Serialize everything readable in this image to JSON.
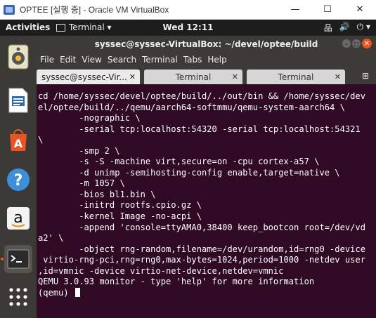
{
  "host": {
    "title": "OPTEE [실행 중] - Oracle VM VirtualBox",
    "controls": {
      "minimize": "—",
      "maximize": "☐",
      "close": "✕"
    }
  },
  "panel": {
    "activities": "Activities",
    "app_menu": "Terminal ▾",
    "clock": "Wed 12:11",
    "tray": {
      "network": "品",
      "volume": "🔊",
      "power": "⏻ ▾"
    }
  },
  "dock": {
    "items": [
      {
        "name": "rhythmbox"
      },
      {
        "name": "libreoffice-writer"
      },
      {
        "name": "ubuntu-software"
      },
      {
        "name": "help"
      },
      {
        "name": "amazon"
      },
      {
        "name": "terminal"
      },
      {
        "name": "show-applications"
      }
    ],
    "accent": "#e95420"
  },
  "terminal": {
    "title": "syssec@syssec-VirtualBox: ~/devel/optee/build",
    "menu": [
      "File",
      "Edit",
      "View",
      "Search",
      "Terminal",
      "Tabs",
      "Help"
    ],
    "tabs": [
      {
        "label": "syssec@syssec-Vir...",
        "active": true,
        "close": "✕"
      },
      {
        "label": "Terminal",
        "active": false,
        "close": "✕"
      },
      {
        "label": "Terminal",
        "active": false,
        "close": "✕"
      }
    ],
    "lines": [
      "cd /home/syssec/devel/optee/build/../out/bin && /home/syssec/dev",
      "el/optee/build/../qemu/aarch64-softmmu/qemu-system-aarch64 \\",
      "        -nographic \\",
      "        -serial tcp:localhost:54320 -serial tcp:localhost:54321",
      "\\",
      "        -smp 2 \\",
      "        -s -S -machine virt,secure=on -cpu cortex-a57 \\",
      "        -d unimp -semihosting-config enable,target=native \\",
      "        -m 1057 \\",
      "        -bios bl1.bin \\",
      "        -initrd rootfs.cpio.gz \\",
      "        -kernel Image -no-acpi \\",
      "        -append 'console=ttyAMA0,38400 keep_bootcon root=/dev/vd",
      "a2' \\",
      "        -object rng-random,filename=/dev/urandom,id=rng0 -device",
      " virtio-rng-pci,rng=rng0,max-bytes=1024,period=1000 -netdev user",
      ",id=vmnic -device virtio-net-device,netdev=vmnic",
      "QEMU 3.0.93 monitor - type 'help' for more information",
      "(qemu) "
    ],
    "colors": {
      "background": "#300a24",
      "foreground": "#ffffff"
    }
  }
}
